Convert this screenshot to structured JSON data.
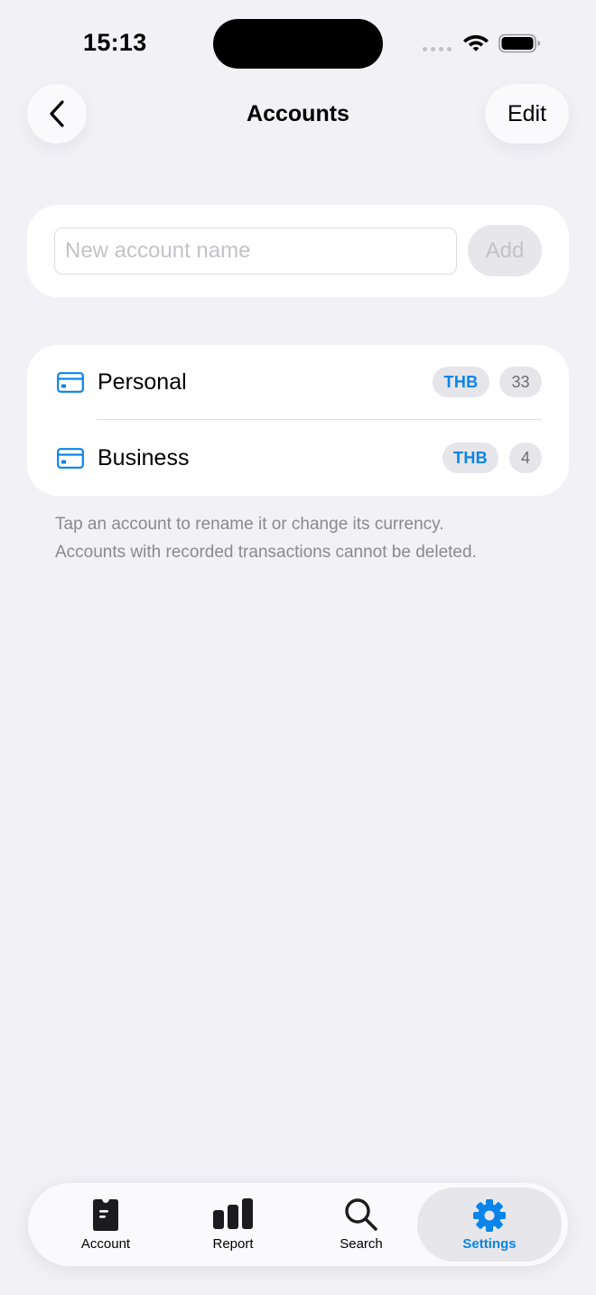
{
  "status_bar": {
    "time": "15:13"
  },
  "nav": {
    "title": "Accounts",
    "edit_label": "Edit"
  },
  "add_account": {
    "placeholder": "New account name",
    "add_label": "Add"
  },
  "accounts": [
    {
      "name": "Personal",
      "currency": "THB",
      "count": "33"
    },
    {
      "name": "Business",
      "currency": "THB",
      "count": "4"
    }
  ],
  "footnote": {
    "line1": "Tap an account to rename it or change its currency.",
    "line2": "Accounts with recorded transactions cannot be deleted."
  },
  "tabs": [
    {
      "label": "Account",
      "icon": "account-icon"
    },
    {
      "label": "Report",
      "icon": "report-icon"
    },
    {
      "label": "Search",
      "icon": "search-icon"
    },
    {
      "label": "Settings",
      "icon": "gear-icon",
      "selected": true
    }
  ],
  "colors": {
    "accent": "#0a84e8",
    "background": "#f1f1f6",
    "card": "#ffffff"
  }
}
